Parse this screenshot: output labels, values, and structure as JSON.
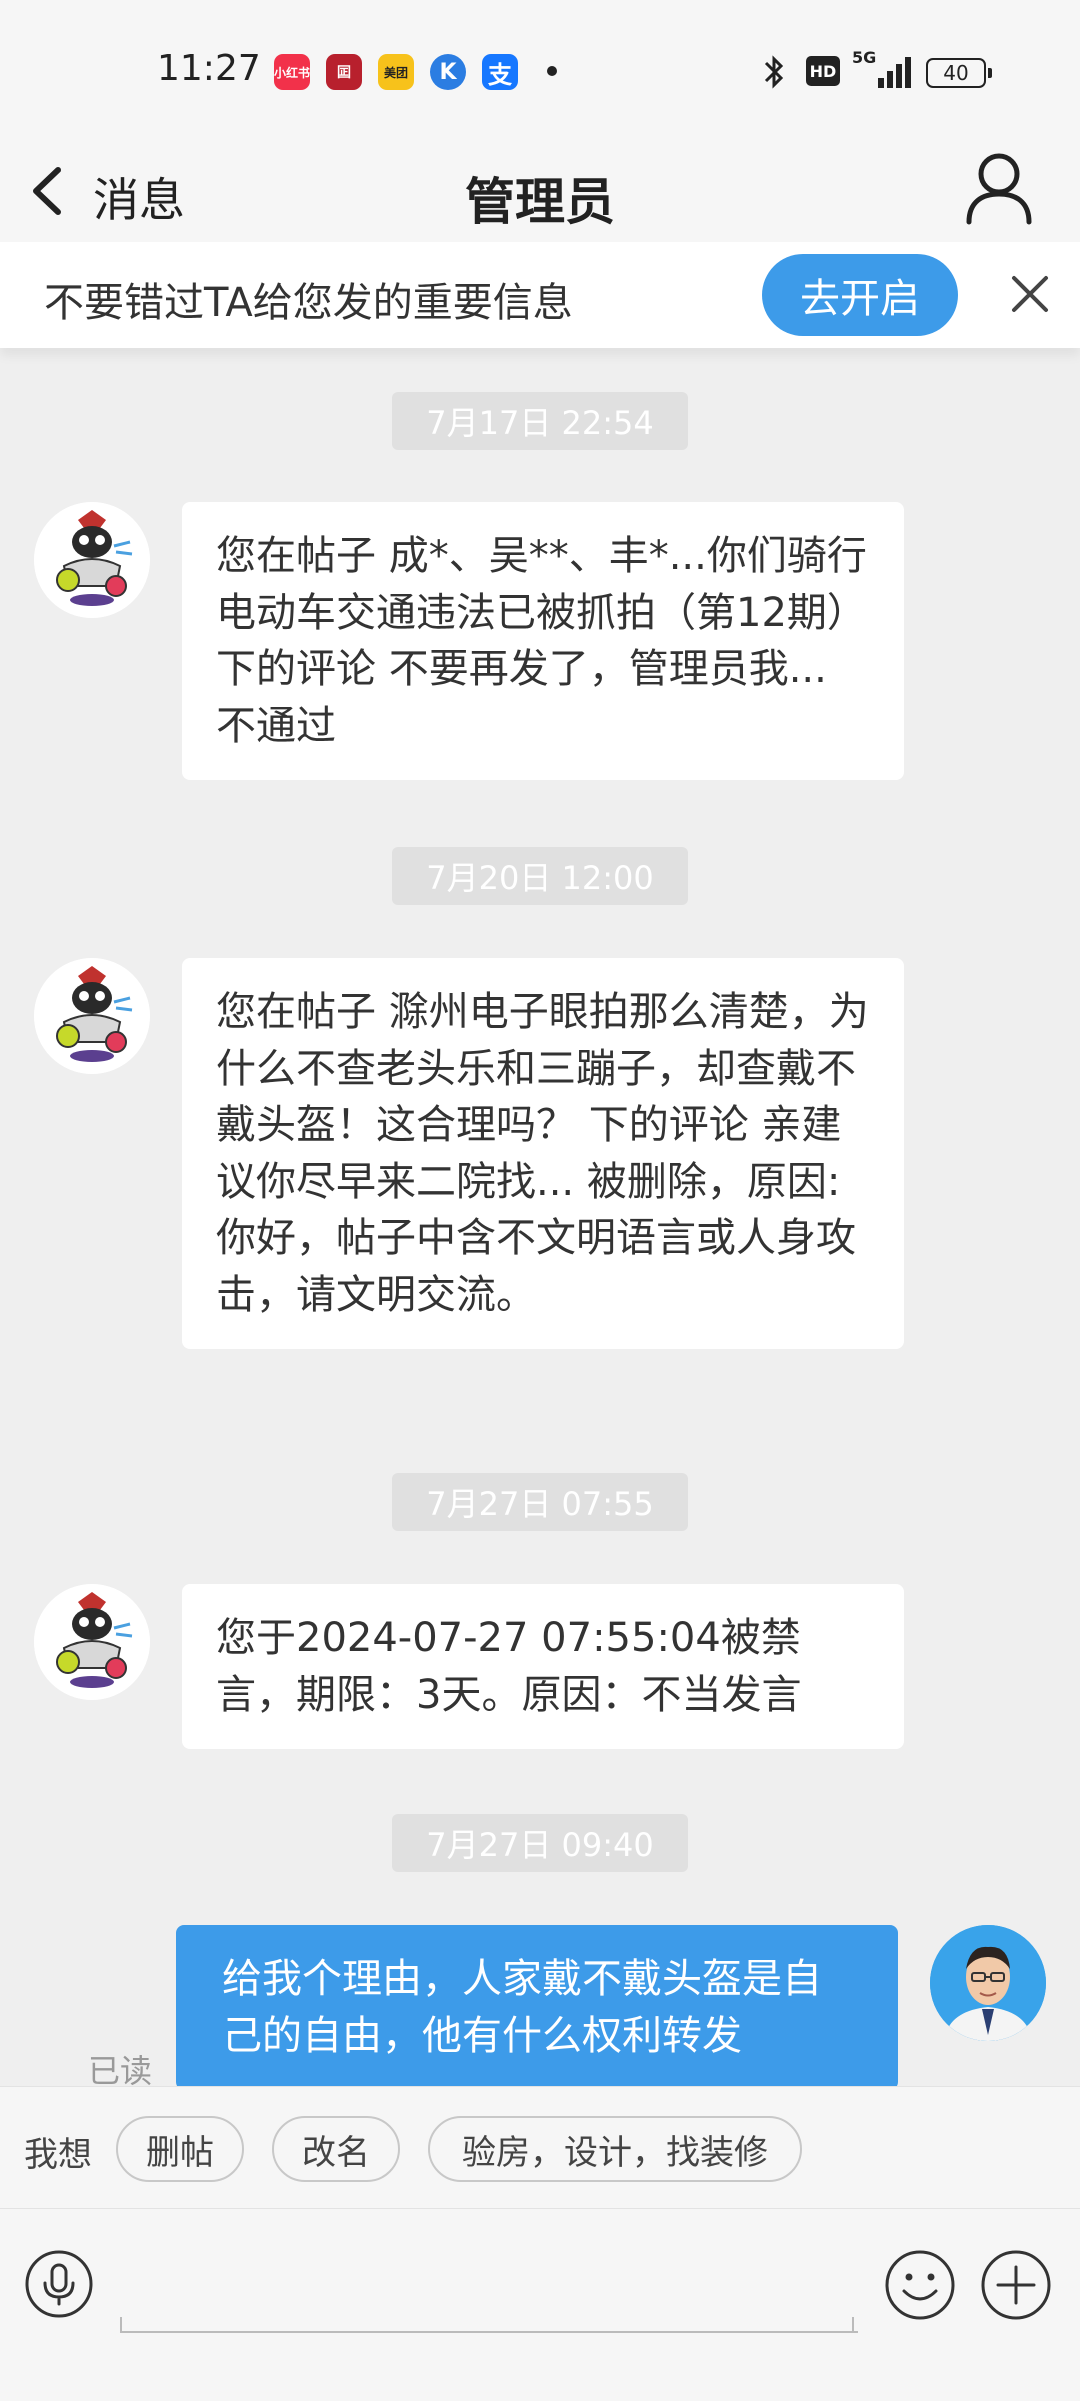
{
  "status_bar": {
    "time": "11:27",
    "apps": [
      {
        "name": "xiaohongshu-icon",
        "label": "小红书",
        "color": "#f2314a"
      },
      {
        "name": "bank-icon",
        "label": "囸",
        "color": "#b8202d"
      },
      {
        "name": "meituan-icon",
        "label": "美团",
        "color": "#f7c21b"
      },
      {
        "name": "k-app-icon",
        "label": "K",
        "color": "#2b7de2"
      },
      {
        "name": "alipay-icon",
        "label": "支",
        "color": "#1677ff"
      }
    ],
    "hd": "HD",
    "network": "5G",
    "battery": "40"
  },
  "header": {
    "back_label": "消息",
    "title": "管理员"
  },
  "banner": {
    "text": "不要错过TA给您发的重要信息",
    "button": "去开启"
  },
  "messages": [
    {
      "timestamp": "7月17日 22:54",
      "text": "您在帖子 成*、吴**、丰*...你们骑行电动车交通违法已被抓拍（第12期） 下的评论 不要再发了，管理员我... 不通过"
    },
    {
      "timestamp": "7月20日 12:00",
      "text": "您在帖子 滁州电子眼拍那么清楚，为什么不查老头乐和三蹦子，却查戴不戴头盔！这合理吗？ 下的评论 亲建议你尽早来二院找... 被删除，原因:你好，帖子中含不文明语言或人身攻击，请文明交流。"
    },
    {
      "timestamp": "7月27日 07:55",
      "text": "您于2024-07-27 07:55:04被禁言，期限：3天。原因：不当发言"
    }
  ],
  "my_message": {
    "timestamp": "7月27日 09:40",
    "text": "给我个理由，人家戴不戴头盔是自己的自由，他有什么权利转发",
    "read_status": "已读"
  },
  "quick_replies": {
    "label": "我想",
    "chips": [
      "删帖",
      "改名",
      "验房，设计，找装修"
    ]
  },
  "colors": {
    "accent": "#3d9be9",
    "background": "#efefef"
  }
}
